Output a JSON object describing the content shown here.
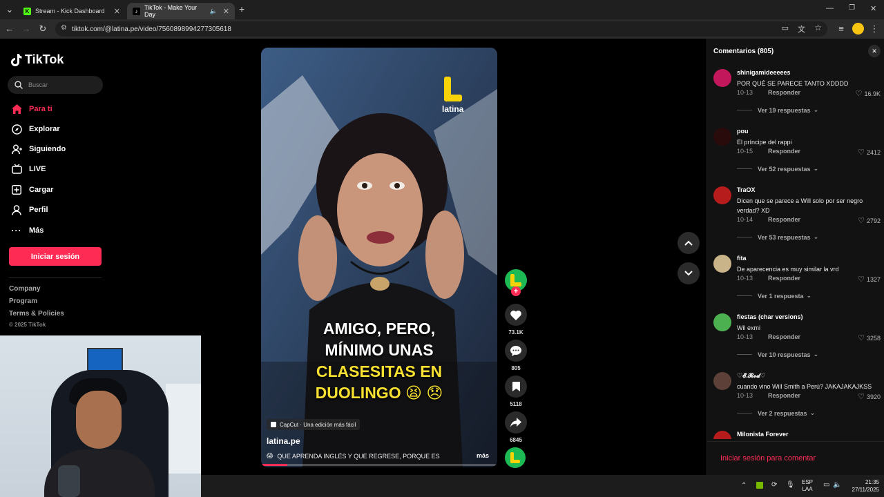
{
  "browser": {
    "tabs": [
      {
        "label": "Stream - Kick Dashboard",
        "active": false
      },
      {
        "label": "TikTok - Make Your Day",
        "active": true
      }
    ],
    "new_tab": "+",
    "url": "tiktok.com/@latina.pe/video/7560898994277305618"
  },
  "sidebar": {
    "logo": "TikTok",
    "search_placeholder": "Buscar",
    "items": [
      {
        "label": "Para ti",
        "icon": "home-icon",
        "active": true
      },
      {
        "label": "Explorar",
        "icon": "compass-icon"
      },
      {
        "label": "Siguiendo",
        "icon": "following-icon"
      },
      {
        "label": "LIVE",
        "icon": "live-icon"
      },
      {
        "label": "Cargar",
        "icon": "upload-icon"
      },
      {
        "label": "Perfil",
        "icon": "profile-icon"
      },
      {
        "label": "Más",
        "icon": "more-icon"
      }
    ],
    "login_button": "Iniciar sesión",
    "footer": [
      "Company",
      "Program",
      "Terms & Policies"
    ],
    "copyright": "© 2025 TikTok"
  },
  "video": {
    "channel_logo": "latina",
    "caption_lines": [
      "AMIGO, PERO,",
      "MÍNIMO UNAS",
      "CLASESITAS EN",
      "DUOLINGO"
    ],
    "capcut": "CapCut · Una edición más fácil",
    "author": "latina.pe",
    "description": "QUE APRENDA INGLÉS Y QUE REGRESE, PORQUE ES",
    "more": "más",
    "progress": 0.11
  },
  "actions": {
    "likes": "73.1K",
    "comments": "805",
    "saves": "5118",
    "shares": "6845"
  },
  "comments_panel": {
    "title": "Comentarios (805)",
    "login_prompt": "Iniciar sesión para comentar",
    "items": [
      {
        "user": "shinigamideeeees",
        "text": "POR QUÉ SE PARECE TANTO XDDDD",
        "date": "10-13",
        "reply": "Responder",
        "likes": "16.9K",
        "more": "Ver 19 respuestas",
        "avatar_color": "#c2185b"
      },
      {
        "user": "pou",
        "text": "El príncipe del rappi",
        "date": "10-15",
        "reply": "Responder",
        "likes": "2412",
        "more": "Ver 52 respuestas",
        "avatar_color": "#2a0b0b"
      },
      {
        "user": "TraOX",
        "text": "Dicen que se parece a Will solo por ser negro verdad? XD",
        "date": "10-14",
        "reply": "Responder",
        "likes": "2792",
        "more": "Ver 53 respuestas",
        "avatar_color": "#b71c1c"
      },
      {
        "user": "fita",
        "text": "De aparecencia es muy similar la vrd",
        "date": "10-13",
        "reply": "Responder",
        "likes": "1327",
        "more": "Ver 1 respuesta",
        "avatar_color": "#c9b48a"
      },
      {
        "user": "fiestas (char versions)",
        "text": "Wil exmi",
        "date": "10-13",
        "reply": "Responder",
        "likes": "3258",
        "more": "Ver 10 respuestas",
        "avatar_color": "#4caf50"
      },
      {
        "user": "♡𝓔.𝓡𝓸𝓭♡",
        "text": "cuando vino Will Smith a Perú? JAKAJAKAJKSS",
        "date": "10-13",
        "reply": "Responder",
        "likes": "3920",
        "more": "Ver 2 respuestas",
        "avatar_color": "#5d4037"
      },
      {
        "user": "Milonista Forever",
        "text": "",
        "date": "",
        "reply": "",
        "likes": "",
        "more": "",
        "avatar_color": "#b71c1c"
      }
    ]
  },
  "taskbar": {
    "lang1": "ESP",
    "lang2": "LAA",
    "time": "21:35",
    "date": "27/11/2025"
  },
  "colors": {
    "tiktok_red": "#fe2c55",
    "latina_yellow": "#f7d308",
    "latina_green": "#1db954"
  }
}
